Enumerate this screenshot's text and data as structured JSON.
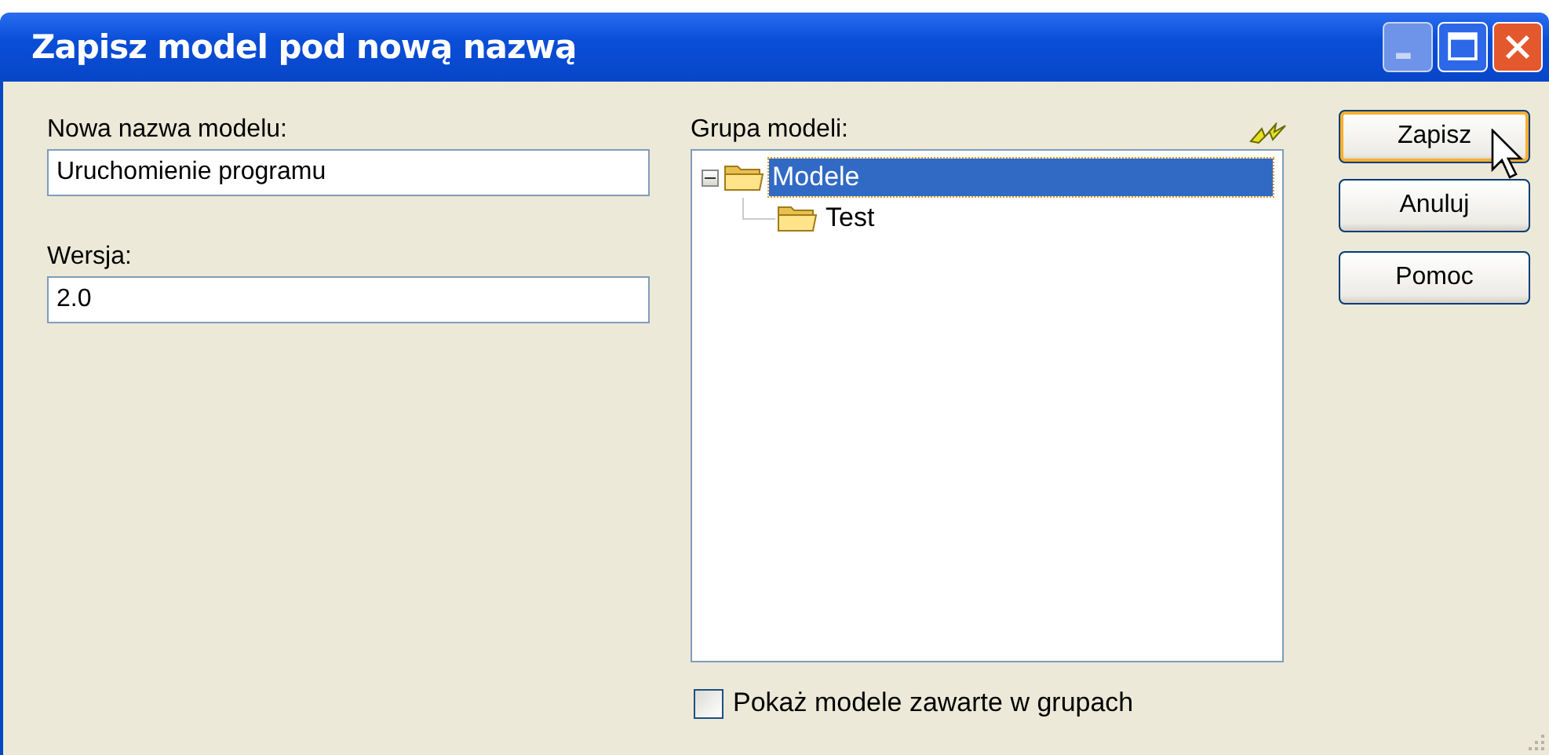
{
  "window": {
    "title": "Zapisz model pod nową nazwą"
  },
  "fields": [
    {
      "label": "Nowa nazwa modelu:",
      "value": "Uruchomienie programu"
    },
    {
      "label": "Wersja:",
      "value": "2.0"
    }
  ],
  "group": {
    "label": "Grupa modeli:",
    "tree": [
      {
        "label": "Modele",
        "expanded": true,
        "selected": true,
        "children": [
          {
            "label": "Test",
            "selected": false
          }
        ]
      }
    ]
  },
  "checkbox": {
    "label": "Pokaż modele zawarte w grupach",
    "checked": false
  },
  "buttons": [
    {
      "label": "Zapisz",
      "default": true
    },
    {
      "label": "Anuluj",
      "default": false
    },
    {
      "label": "Pomoc",
      "default": false
    }
  ]
}
